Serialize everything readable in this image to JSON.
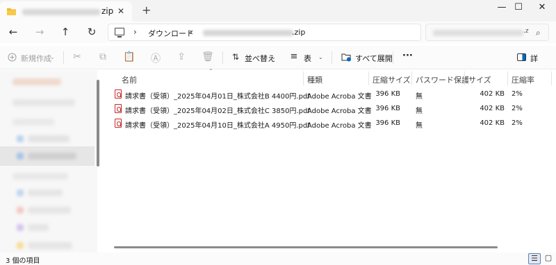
{
  "tab": {
    "title_suffix": "zip",
    "close": "✕",
    "new_tab": "+"
  },
  "window_controls": {
    "minimize": "—",
    "maximize": "☐",
    "close": "✕"
  },
  "nav": {
    "back": "←",
    "forward": "→",
    "up": "↑",
    "refresh": "↻"
  },
  "address": {
    "separator": "›",
    "crumb": "ダウンロード",
    "zip_suffix": ".zip"
  },
  "search": {
    "suffix": ".z",
    "icon": "⌕"
  },
  "commands": {
    "new": "新規作成",
    "sort": "並べ替え",
    "view": "表",
    "extract_all": "すべて展開",
    "more": "···",
    "details": "詳"
  },
  "columns": [
    "名前",
    "種類",
    "圧縮サイズ",
    "パスワード保護",
    "サイズ",
    "圧縮率"
  ],
  "files": [
    {
      "name": "請求書（受領）_2025年04月01日_株式会社B 4400円.pdf",
      "type": "Adobe Acroba 文書",
      "compressed": "396 KB",
      "password": "無",
      "size": "402 KB",
      "ratio": "2%"
    },
    {
      "name": "請求書（受領）_2025年04月02日_株式会社C 3850円.pdf",
      "type": "Adobe Acroba 文書",
      "compressed": "396 KB",
      "password": "無",
      "size": "402 KB",
      "ratio": "2%"
    },
    {
      "name": "請求書（受領）_2025年04月10日_株式会社A 4950円.pdf",
      "type": "Adobe Acroba 文書",
      "compressed": "396 KB",
      "password": "無",
      "size": "402 KB",
      "ratio": "2%"
    }
  ],
  "status": {
    "item_count": "3 個の項目"
  },
  "colors": {
    "accent": "#0067c0",
    "pdf_red": "#c62828",
    "folder_yellow": "#f0b429"
  }
}
